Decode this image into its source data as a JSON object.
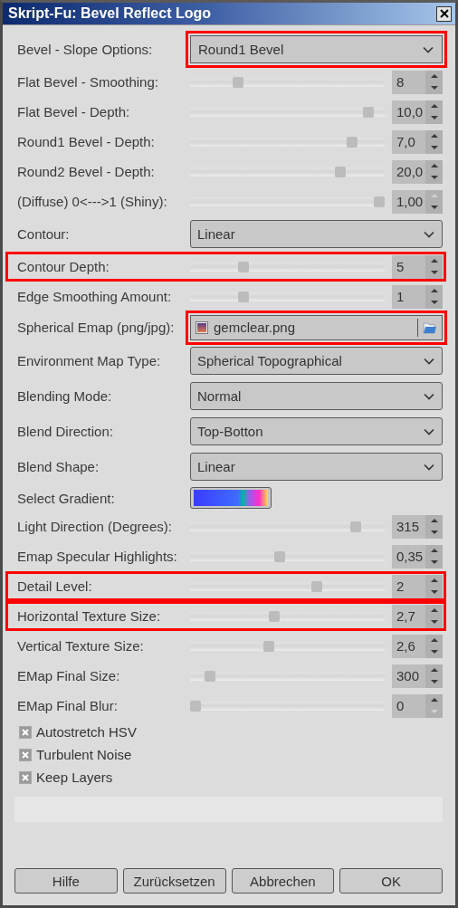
{
  "window": {
    "title": "Skript-Fu: Bevel Reflect Logo"
  },
  "options": [
    {
      "kind": "combo",
      "label": "Bevel - Slope Options:",
      "value": "Round1 Bevel",
      "highlighted": true
    },
    {
      "kind": "slider",
      "label": "Flat Bevel - Smoothing:",
      "value": "8",
      "level": 0.23,
      "up_disabled": false,
      "down_disabled": false,
      "highlighted": false
    },
    {
      "kind": "slider",
      "label": "Flat Bevel - Depth:",
      "value": "10,0",
      "level": 0.94,
      "up_disabled": false,
      "down_disabled": false,
      "highlighted": false
    },
    {
      "kind": "slider",
      "label": "Round1 Bevel - Depth:",
      "value": "7,0",
      "level": 0.85,
      "up_disabled": false,
      "down_disabled": false,
      "highlighted": false
    },
    {
      "kind": "slider",
      "label": "Round2 Bevel - Depth:",
      "value": "20,0",
      "level": 0.79,
      "up_disabled": false,
      "down_disabled": false,
      "highlighted": false
    },
    {
      "kind": "slider",
      "label": "(Diffuse) 0<--->1 (Shiny):",
      "value": "1,00",
      "level": 1,
      "up_disabled": true,
      "down_disabled": false,
      "highlighted": false
    },
    {
      "kind": "combo",
      "label": "Contour:",
      "value": "Linear",
      "highlighted": false
    },
    {
      "kind": "slider",
      "label": "Contour Depth:",
      "value": "5",
      "level": 0.26,
      "up_disabled": false,
      "down_disabled": false,
      "highlighted": true
    },
    {
      "kind": "slider",
      "label": "Edge Smoothing Amount:",
      "value": "1",
      "level": 0.26,
      "up_disabled": false,
      "down_disabled": false,
      "highlighted": false
    },
    {
      "kind": "file",
      "label": "Spherical Emap (png/jpg):",
      "value": "gemclear.png",
      "highlighted": true
    },
    {
      "kind": "combo",
      "label": "Environment Map Type:",
      "value": "Spherical Topographical",
      "highlighted": false
    },
    {
      "kind": "combo",
      "label": "Blending Mode:",
      "value": "Normal",
      "highlighted": false
    },
    {
      "kind": "combo",
      "label": "Blend Direction:",
      "value": "Top-Botton",
      "highlighted": false
    },
    {
      "kind": "combo",
      "label": "Blend Shape:",
      "value": "Linear",
      "highlighted": false
    },
    {
      "kind": "gradient",
      "label": "Select Gradient:",
      "highlighted": false
    },
    {
      "kind": "slider",
      "label": "Light Direction (Degrees):",
      "value": "315",
      "level": 0.87,
      "up_disabled": false,
      "down_disabled": false,
      "highlighted": false
    },
    {
      "kind": "slider",
      "label": "Emap Specular Highlights:",
      "value": "0,35",
      "level": 0.46,
      "up_disabled": false,
      "down_disabled": false,
      "highlighted": false
    },
    {
      "kind": "slider",
      "label": "Detail Level:",
      "value": "2",
      "level": 0.66,
      "up_disabled": false,
      "down_disabled": false,
      "highlighted": true
    },
    {
      "kind": "slider",
      "label": "Horizontal Texture Size:",
      "value": "2,7",
      "level": 0.43,
      "up_disabled": false,
      "down_disabled": false,
      "highlighted": true
    },
    {
      "kind": "slider",
      "label": "Vertical Texture Size:",
      "value": "2,6",
      "level": 0.4,
      "up_disabled": false,
      "down_disabled": false,
      "highlighted": false
    },
    {
      "kind": "slider",
      "label": "EMap Final Size:",
      "value": "300",
      "level": 0.08,
      "up_disabled": false,
      "down_disabled": false,
      "highlighted": false
    },
    {
      "kind": "slider",
      "label": "EMap Final Blur:",
      "value": "0",
      "level": 0,
      "up_disabled": false,
      "down_disabled": true,
      "highlighted": false
    }
  ],
  "checkboxes": [
    {
      "label": "Autostretch HSV",
      "checked": true
    },
    {
      "label": "Turbulent Noise",
      "checked": true
    },
    {
      "label": "Keep Layers",
      "checked": true
    }
  ],
  "buttons": [
    "Hilfe",
    "Zurücksetzen",
    "Abbrechen",
    "OK"
  ]
}
